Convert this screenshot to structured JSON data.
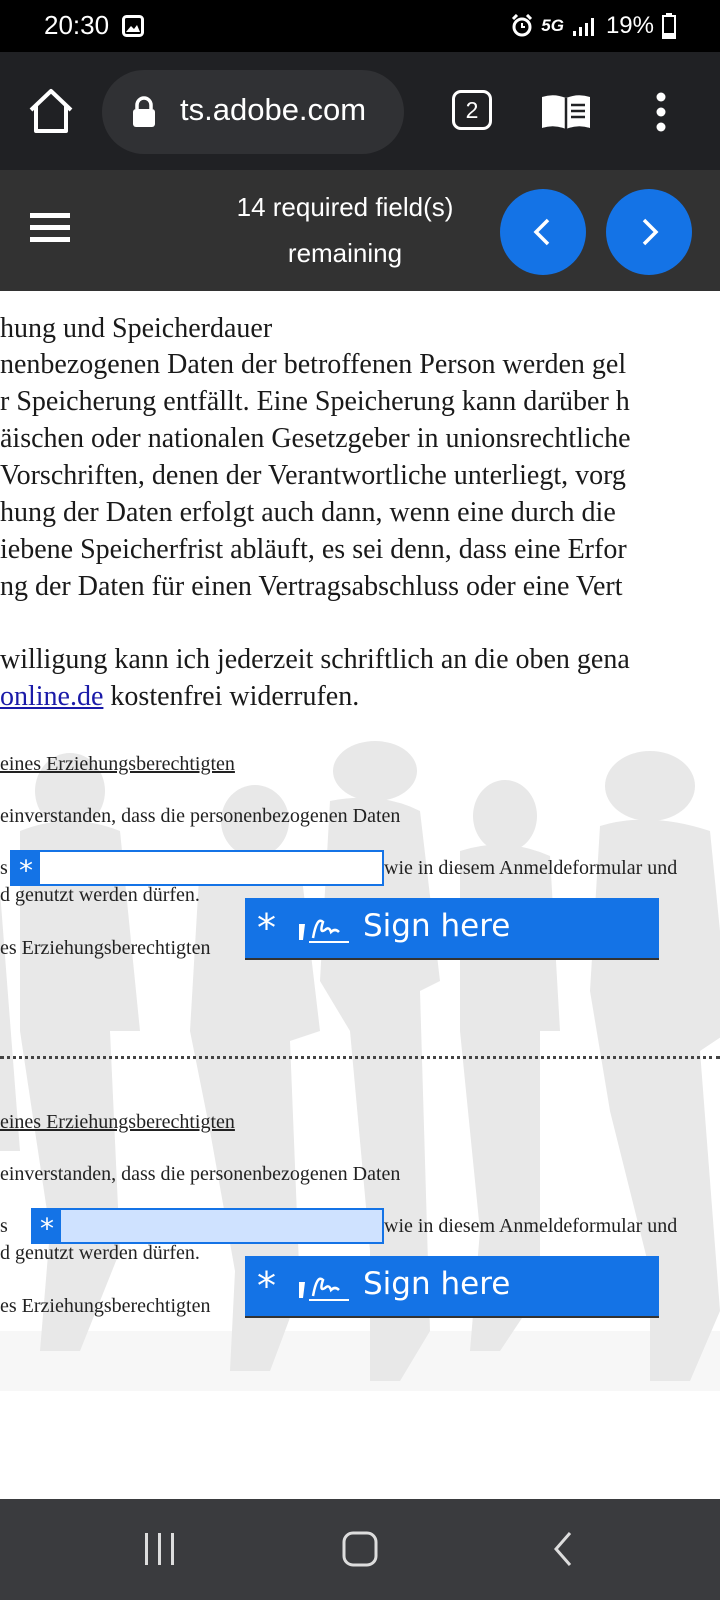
{
  "status_bar": {
    "time": "20:30",
    "network": "5G",
    "battery": "19%"
  },
  "browser": {
    "url": "ts.adobe.com",
    "tab_count": "2"
  },
  "sign_toolbar": {
    "remaining_line1": "14 required field(s)",
    "remaining_line2": "remaining"
  },
  "document": {
    "heading": "hung und Speicherdauer",
    "paragraph_lines": [
      "nenbezogenen Daten der betroffenen Person werden gel",
      "r Speicherung entfällt. Eine Speicherung kann darüber h",
      "äischen oder nationalen Gesetzgeber in unionsrechtliche",
      "Vorschriften, denen der Verantwortliche unterliegt, vorg",
      "hung der Daten erfolgt auch dann, wenn eine durch die",
      "iebene Speicherfrist abläuft, es sei denn, dass eine Erfor",
      "ng der Daten für einen Vertragsabschluss oder eine Vert"
    ],
    "consent_line1": "willigung kann ich jederzeit schriftlich an die oben gena",
    "consent_link": "online.de",
    "consent_line2_rest": " kostenfrei widerrufen.",
    "sections": [
      {
        "title": "eines Erziehungsberechtigten",
        "agree_text": "einverstanden, dass die personenbezogenen Daten",
        "field_prefix": "s",
        "field_suffix": "wie in diesem Anmeldeformular und",
        "use_text": "d genutzt werden dürfen.",
        "sign_prefix": "es Erziehungsberechtigten",
        "field_star": "*",
        "sign_star": "*",
        "sign_label": "Sign here"
      },
      {
        "title": "eines Erziehungsberechtigten",
        "agree_text": "einverstanden, dass die personenbezogenen Daten",
        "field_prefix": "s",
        "field_suffix": "wie in diesem Anmeldeformular und",
        "use_text": "d genutzt werden dürfen.",
        "sign_prefix": "es Erziehungsberechtigten",
        "field_star": "*",
        "sign_star": "*",
        "sign_label": "Sign here"
      }
    ]
  },
  "icons": {
    "home": "home-icon",
    "lock": "lock-icon",
    "reader": "reader-mode-icon",
    "menu": "more-vert-icon",
    "hamburger": "hamburger-icon",
    "prev": "chevron-left-icon",
    "next": "chevron-right-icon",
    "sign": "signature-icon"
  },
  "colors": {
    "accent": "#1473e6",
    "toolbar": "#323232",
    "browser_bar": "#202124"
  }
}
